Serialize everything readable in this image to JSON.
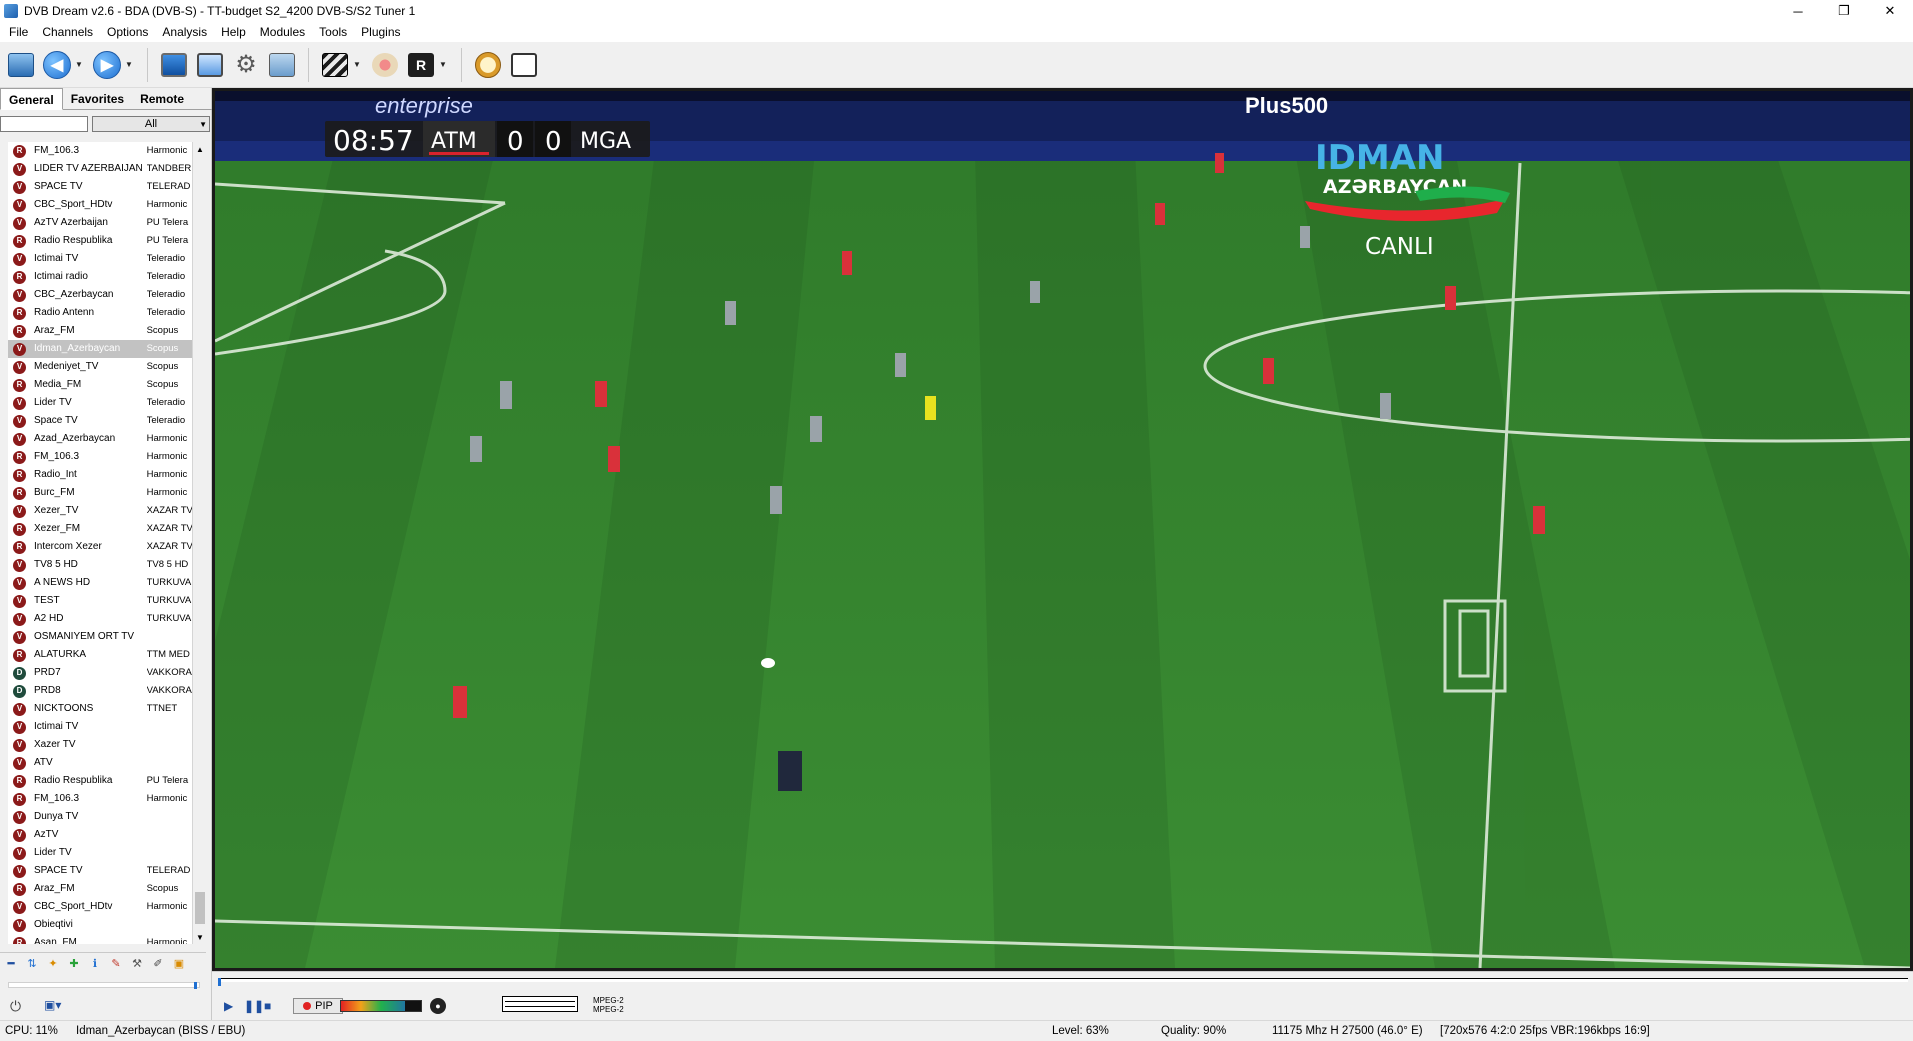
{
  "window": {
    "title": "DVB Dream v2.6 - BDA (DVB-S)  -  TT-budget S2_4200 DVB-S/S2 Tuner 1",
    "minimize": "─",
    "maximize": "❐",
    "close": "✕"
  },
  "menu": [
    "File",
    "Channels",
    "Options",
    "Analysis",
    "Help",
    "Modules",
    "Tools",
    "Plugins"
  ],
  "sidebar": {
    "tabs": [
      "General",
      "Favorites",
      "Remote"
    ],
    "search_value": "",
    "filter_value": "All",
    "channels": [
      {
        "icon": "R",
        "name": "FM_106.3",
        "provider": "Harmonic"
      },
      {
        "icon": "V",
        "name": "LIDER TV AZERBAIJAN",
        "provider": "TANDBER"
      },
      {
        "icon": "V",
        "name": "SPACE TV",
        "provider": "TELERAD"
      },
      {
        "icon": "V",
        "name": "CBC_Sport_HDtv",
        "provider": "Harmonic"
      },
      {
        "icon": "V",
        "name": "AzTV Azerbaijan",
        "provider": "PU Telera"
      },
      {
        "icon": "R",
        "name": "Radio Respublika",
        "provider": "PU Telera"
      },
      {
        "icon": "V",
        "name": "Ictimai TV",
        "provider": "Teleradio"
      },
      {
        "icon": "R",
        "name": "Ictimai radio",
        "provider": "Teleradio"
      },
      {
        "icon": "V",
        "name": "CBC_Azerbaycan",
        "provider": "Teleradio"
      },
      {
        "icon": "R",
        "name": "Radio Antenn",
        "provider": "Teleradio"
      },
      {
        "icon": "R",
        "name": "Araz_FM",
        "provider": "Scopus"
      },
      {
        "icon": "V",
        "name": "Idman_Azerbaycan",
        "provider": "Scopus"
      },
      {
        "icon": "V",
        "name": "Medeniyet_TV",
        "provider": "Scopus"
      },
      {
        "icon": "R",
        "name": "Media_FM",
        "provider": "Scopus"
      },
      {
        "icon": "V",
        "name": "Lider TV",
        "provider": "Teleradio"
      },
      {
        "icon": "V",
        "name": "Space TV",
        "provider": "Teleradio"
      },
      {
        "icon": "V",
        "name": "Azad_Azerbaycan",
        "provider": "Harmonic"
      },
      {
        "icon": "R",
        "name": "FM_106.3",
        "provider": "Harmonic"
      },
      {
        "icon": "R",
        "name": "Radio_Int",
        "provider": "Harmonic"
      },
      {
        "icon": "R",
        "name": "Burc_FM",
        "provider": "Harmonic"
      },
      {
        "icon": "V",
        "name": "Xezer_TV",
        "provider": "XAZAR TV"
      },
      {
        "icon": "R",
        "name": "Xezer_FM",
        "provider": "XAZAR TV"
      },
      {
        "icon": "R",
        "name": "Intercom Xezer",
        "provider": "XAZAR TV"
      },
      {
        "icon": "V",
        "name": "TV8 5 HD",
        "provider": "TV8 5 HD"
      },
      {
        "icon": "V",
        "name": "A NEWS HD",
        "provider": "TURKUVA"
      },
      {
        "icon": "V",
        "name": "TEST",
        "provider": "TURKUVA"
      },
      {
        "icon": "V",
        "name": "A2 HD",
        "provider": "TURKUVA"
      },
      {
        "icon": "V",
        "name": "OSMANIYEM ORT TV",
        "provider": ""
      },
      {
        "icon": "R",
        "name": "ALATURKA",
        "provider": "TTM MED"
      },
      {
        "icon": "D",
        "name": "PRD7",
        "provider": "VAKKORA"
      },
      {
        "icon": "D",
        "name": "PRD8",
        "provider": "VAKKORA"
      },
      {
        "icon": "V",
        "name": "NICKTOONS",
        "provider": "TTNET"
      },
      {
        "icon": "V",
        "name": "Ictimai TV",
        "provider": ""
      },
      {
        "icon": "V",
        "name": "Xazer TV",
        "provider": ""
      },
      {
        "icon": "V",
        "name": "ATV",
        "provider": ""
      },
      {
        "icon": "R",
        "name": "Radio Respublika",
        "provider": "PU Telera"
      },
      {
        "icon": "R",
        "name": "FM_106.3",
        "provider": "Harmonic"
      },
      {
        "icon": "V",
        "name": "Dunya TV",
        "provider": ""
      },
      {
        "icon": "V",
        "name": "AzTV",
        "provider": ""
      },
      {
        "icon": "V",
        "name": "Lider TV",
        "provider": ""
      },
      {
        "icon": "V",
        "name": "SPACE TV",
        "provider": "TELERAD"
      },
      {
        "icon": "R",
        "name": "Araz_FM",
        "provider": "Scopus"
      },
      {
        "icon": "V",
        "name": "CBC_Sport_HDtv",
        "provider": "Harmonic"
      },
      {
        "icon": "V",
        "name": "Obieqtivi",
        "provider": ""
      },
      {
        "icon": "R",
        "name": "Asan_FM",
        "provider": "Harmonic"
      }
    ],
    "selected_index": 11
  },
  "video": {
    "clock": "08:57",
    "home_team": "ATM",
    "home_score": "0",
    "away_score": "0",
    "away_team": "MGA",
    "channel_logo_line1": "IDMAN",
    "channel_logo_line2": "AZƏRBAYCAN",
    "live_label": "CANLI",
    "ad_banner_1": "enterprise",
    "ad_banner_2": "Plus500"
  },
  "controls": {
    "pip_label": "PIP",
    "codec_video": "MPEG-2",
    "codec_audio": "MPEG-2",
    "signal_level": 0.8
  },
  "status": {
    "cpu": "CPU: 11%",
    "channel": "Idman_Azerbaycan (BISS / EBU)",
    "level": "Level: 63%",
    "quality": "Quality: 90%",
    "frequency": "11175 Mhz  H  27500  (46.0° E)",
    "format": "[720x576 4:2:0 25fps  VBR:196kbps  16:9]"
  }
}
